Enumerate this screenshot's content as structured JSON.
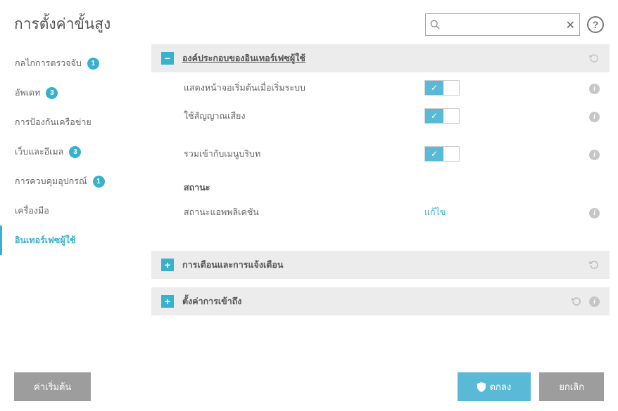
{
  "page": {
    "title": "การตั้งค่าขั้นสูง"
  },
  "search": {
    "placeholder": ""
  },
  "sidebar": {
    "items": [
      {
        "label": "กลไกการตรวจจับ",
        "badge": "1"
      },
      {
        "label": "อัพเดท",
        "badge": "3"
      },
      {
        "label": "การป้องกันเครือข่าย",
        "badge": ""
      },
      {
        "label": "เว็บและอีเมล",
        "badge": "3"
      },
      {
        "label": "การควบคุมอุปกรณ์",
        "badge": "1"
      },
      {
        "label": "เครื่องมือ",
        "badge": ""
      },
      {
        "label": "อินเทอร์เฟซผู้ใช้",
        "badge": ""
      }
    ]
  },
  "sections": {
    "ui_components": {
      "title": "องค์ประกอบของอินเทอร์เฟซผู้ใช้",
      "rows": {
        "show_startup": "แสดงหน้าจอเริ่มต้นเมื่อเริ่มระบบ",
        "use_sound": "ใช้สัญญาณเสียง",
        "integrate_menu": "รวมเข้ากับเมนูบริบท"
      },
      "status_heading": "สถานะ",
      "app_status_label": "สถานะแอพพลิเคชัน",
      "app_status_action": "แก้ไข"
    },
    "alerts": {
      "title": "การเตือนและการแจ้งเตือน"
    },
    "access": {
      "title": "ตั้งค่าการเข้าถึง"
    }
  },
  "footer": {
    "default": "ค่าเริ่มต้น",
    "ok": "ตกลง",
    "cancel": "ยกเลิก"
  }
}
